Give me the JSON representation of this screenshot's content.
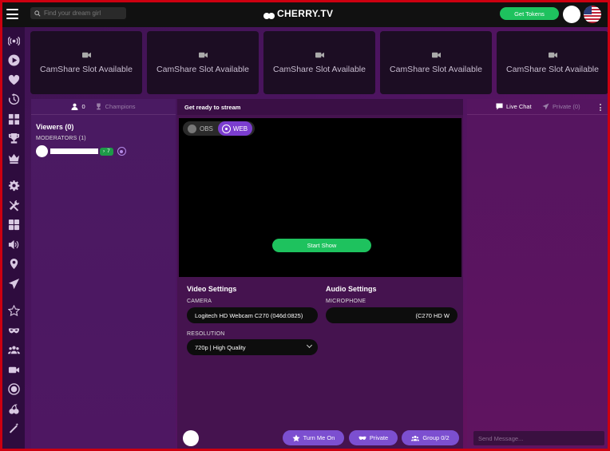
{
  "header": {
    "search_placeholder": "Find your dream girl",
    "logo_text": "CHERRY.TV",
    "get_tokens_label": "Get Tokens"
  },
  "nav_icons": [
    "broadcast-icon",
    "play-icon",
    "heart-icon",
    "history-icon",
    "grid-icon",
    "trophy-icon",
    "crown-icon",
    "gear-icon",
    "tools-icon",
    "apps-icon",
    "speaker-icon",
    "location-pin-icon",
    "send-icon",
    "star-icon",
    "mask-icon",
    "group-icon",
    "video-camera-icon",
    "record-icon",
    "cherry-icon",
    "wand-icon"
  ],
  "slots": [
    {
      "label": "CamShare Slot Available"
    },
    {
      "label": "CamShare Slot Available"
    },
    {
      "label": "CamShare Slot Available"
    },
    {
      "label": "CamShare Slot Available"
    },
    {
      "label": "CamShare Slot Available"
    }
  ],
  "viewers_panel": {
    "viewer_count": "0",
    "champions_label": "Champions",
    "title": "Viewers (0)",
    "moderators_title": "MODERATORS (1)",
    "moderator_badge": "7"
  },
  "stream_panel": {
    "title": "Get ready to stream",
    "obs_label": "OBS",
    "web_label": "WEB",
    "start_show_label": "Start Show",
    "video_settings_title": "Video Settings",
    "camera_label": "CAMERA",
    "camera_value": "Logitech HD Webcam C270 (046d:0825)",
    "resolution_label": "RESOLUTION",
    "resolution_value": "720p | High Quality",
    "audio_settings_title": "Audio Settings",
    "microphone_label": "MICROPHONE",
    "microphone_value": "(C270 HD W",
    "turn_me_on_label": "Turn Me On",
    "private_label": "Private",
    "group_label": "Group 0/2"
  },
  "chat_panel": {
    "live_chat_label": "Live Chat",
    "private_tab_label": "Private (0)",
    "send_placeholder": "Send Message..."
  },
  "colors": {
    "accent_green": "#1ec25e",
    "accent_purple": "#7c4fd0",
    "frame_red": "#cc0010"
  }
}
